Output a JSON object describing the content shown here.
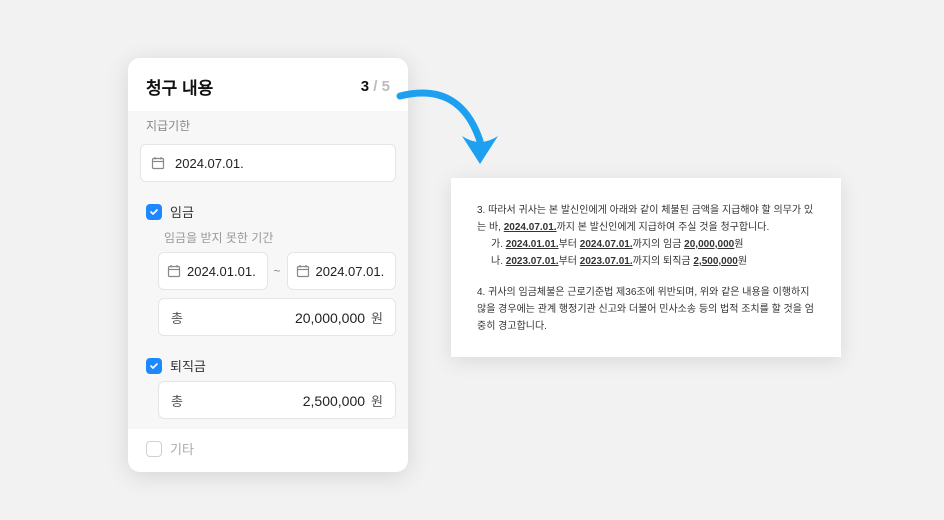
{
  "form": {
    "title": "청구 내용",
    "step_current": "3",
    "step_sep": " / ",
    "step_total": "5",
    "deadline_label": "지급기한",
    "deadline_value": "2024.07.01.",
    "wage": {
      "label": "임금",
      "period_label": "임금을 받지 못한 기간",
      "from": "2024.01.01.",
      "to": "2024.07.01.",
      "tilde": "~",
      "total_label": "총",
      "total_value": "20,000,000",
      "unit": "원"
    },
    "severance": {
      "label": "퇴직금",
      "total_label": "총",
      "total_value": "2,500,000",
      "unit": "원"
    },
    "other_label": "기타"
  },
  "doc": {
    "item3_prefix": "3. 따라서 귀사는 본 발신인에게 아래와 같이 체불된 금액을 지급해야 할 의무가 있는 바, ",
    "item3_date": "2024.07.01.",
    "item3_suffix": "까지 본 발신인에게 지급하여 주실 것을 청구합니다.",
    "item3a_prefix": "가. ",
    "item3a_d1": "2024.01.01.",
    "item3a_mid1": "부터 ",
    "item3a_d2": "2024.07.01.",
    "item3a_mid2": "까지의 임금 ",
    "item3a_amt": "20,000,000",
    "item3a_unit": "원",
    "item3b_prefix": "나. ",
    "item3b_d1": "2023.07.01.",
    "item3b_mid1": "부터 ",
    "item3b_d2": "2023.07.01.",
    "item3b_mid2": "까지의 퇴직금 ",
    "item3b_amt": "2,500,000",
    "item3b_unit": "원",
    "item4": "4. 귀사의 임금체불은 근로기준법 제36조에 위반되며, 위와 같은 내용을 이행하지 않을 경우에는 관계 행정기관 신고와 더불어 민사소송 등의 법적 조치를 할 것을 엄중히 경고합니다."
  }
}
